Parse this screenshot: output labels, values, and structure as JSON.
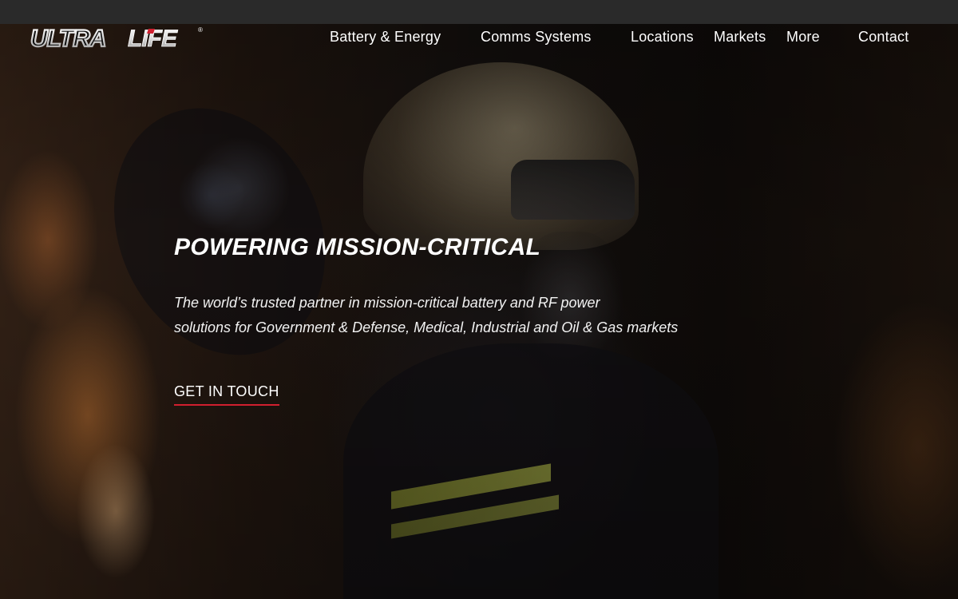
{
  "brand": {
    "logo_text_left": "ULTRA",
    "logo_text_right": "LIFE",
    "registered_mark": "®",
    "accent_color": "#d11f2f"
  },
  "nav": {
    "items": [
      {
        "label": "Battery & Energy"
      },
      {
        "label": "Comms Systems"
      },
      {
        "label": "Locations"
      },
      {
        "label": "Markets"
      },
      {
        "label": "More"
      },
      {
        "label": "Contact"
      }
    ]
  },
  "hero": {
    "title": "POWERING MISSION-CRITICAL",
    "subtitle_line1": "The world’s trusted partner in mission-critical battery and RF power",
    "subtitle_line2": "solutions for Government & Defense, Medical, Industrial and Oil & Gas markets",
    "cta_label": "GET IN TOUCH"
  }
}
